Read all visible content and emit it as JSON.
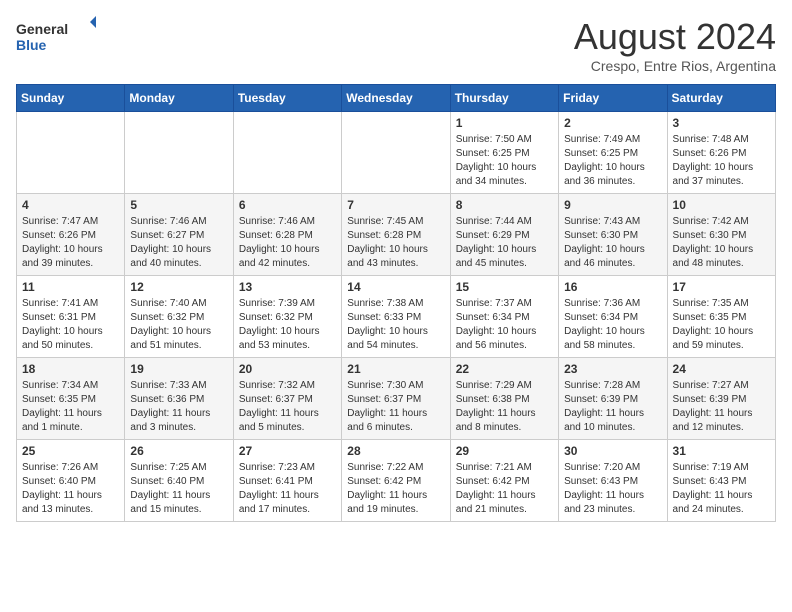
{
  "logo": {
    "line1": "General",
    "line2": "Blue"
  },
  "title": "August 2024",
  "subtitle": "Crespo, Entre Rios, Argentina",
  "weekdays": [
    "Sunday",
    "Monday",
    "Tuesday",
    "Wednesday",
    "Thursday",
    "Friday",
    "Saturday"
  ],
  "weeks": [
    [
      {
        "day": "",
        "info": ""
      },
      {
        "day": "",
        "info": ""
      },
      {
        "day": "",
        "info": ""
      },
      {
        "day": "",
        "info": ""
      },
      {
        "day": "1",
        "info": "Sunrise: 7:50 AM\nSunset: 6:25 PM\nDaylight: 10 hours\nand 34 minutes."
      },
      {
        "day": "2",
        "info": "Sunrise: 7:49 AM\nSunset: 6:25 PM\nDaylight: 10 hours\nand 36 minutes."
      },
      {
        "day": "3",
        "info": "Sunrise: 7:48 AM\nSunset: 6:26 PM\nDaylight: 10 hours\nand 37 minutes."
      }
    ],
    [
      {
        "day": "4",
        "info": "Sunrise: 7:47 AM\nSunset: 6:26 PM\nDaylight: 10 hours\nand 39 minutes."
      },
      {
        "day": "5",
        "info": "Sunrise: 7:46 AM\nSunset: 6:27 PM\nDaylight: 10 hours\nand 40 minutes."
      },
      {
        "day": "6",
        "info": "Sunrise: 7:46 AM\nSunset: 6:28 PM\nDaylight: 10 hours\nand 42 minutes."
      },
      {
        "day": "7",
        "info": "Sunrise: 7:45 AM\nSunset: 6:28 PM\nDaylight: 10 hours\nand 43 minutes."
      },
      {
        "day": "8",
        "info": "Sunrise: 7:44 AM\nSunset: 6:29 PM\nDaylight: 10 hours\nand 45 minutes."
      },
      {
        "day": "9",
        "info": "Sunrise: 7:43 AM\nSunset: 6:30 PM\nDaylight: 10 hours\nand 46 minutes."
      },
      {
        "day": "10",
        "info": "Sunrise: 7:42 AM\nSunset: 6:30 PM\nDaylight: 10 hours\nand 48 minutes."
      }
    ],
    [
      {
        "day": "11",
        "info": "Sunrise: 7:41 AM\nSunset: 6:31 PM\nDaylight: 10 hours\nand 50 minutes."
      },
      {
        "day": "12",
        "info": "Sunrise: 7:40 AM\nSunset: 6:32 PM\nDaylight: 10 hours\nand 51 minutes."
      },
      {
        "day": "13",
        "info": "Sunrise: 7:39 AM\nSunset: 6:32 PM\nDaylight: 10 hours\nand 53 minutes."
      },
      {
        "day": "14",
        "info": "Sunrise: 7:38 AM\nSunset: 6:33 PM\nDaylight: 10 hours\nand 54 minutes."
      },
      {
        "day": "15",
        "info": "Sunrise: 7:37 AM\nSunset: 6:34 PM\nDaylight: 10 hours\nand 56 minutes."
      },
      {
        "day": "16",
        "info": "Sunrise: 7:36 AM\nSunset: 6:34 PM\nDaylight: 10 hours\nand 58 minutes."
      },
      {
        "day": "17",
        "info": "Sunrise: 7:35 AM\nSunset: 6:35 PM\nDaylight: 10 hours\nand 59 minutes."
      }
    ],
    [
      {
        "day": "18",
        "info": "Sunrise: 7:34 AM\nSunset: 6:35 PM\nDaylight: 11 hours\nand 1 minute."
      },
      {
        "day": "19",
        "info": "Sunrise: 7:33 AM\nSunset: 6:36 PM\nDaylight: 11 hours\nand 3 minutes."
      },
      {
        "day": "20",
        "info": "Sunrise: 7:32 AM\nSunset: 6:37 PM\nDaylight: 11 hours\nand 5 minutes."
      },
      {
        "day": "21",
        "info": "Sunrise: 7:30 AM\nSunset: 6:37 PM\nDaylight: 11 hours\nand 6 minutes."
      },
      {
        "day": "22",
        "info": "Sunrise: 7:29 AM\nSunset: 6:38 PM\nDaylight: 11 hours\nand 8 minutes."
      },
      {
        "day": "23",
        "info": "Sunrise: 7:28 AM\nSunset: 6:39 PM\nDaylight: 11 hours\nand 10 minutes."
      },
      {
        "day": "24",
        "info": "Sunrise: 7:27 AM\nSunset: 6:39 PM\nDaylight: 11 hours\nand 12 minutes."
      }
    ],
    [
      {
        "day": "25",
        "info": "Sunrise: 7:26 AM\nSunset: 6:40 PM\nDaylight: 11 hours\nand 13 minutes."
      },
      {
        "day": "26",
        "info": "Sunrise: 7:25 AM\nSunset: 6:40 PM\nDaylight: 11 hours\nand 15 minutes."
      },
      {
        "day": "27",
        "info": "Sunrise: 7:23 AM\nSunset: 6:41 PM\nDaylight: 11 hours\nand 17 minutes."
      },
      {
        "day": "28",
        "info": "Sunrise: 7:22 AM\nSunset: 6:42 PM\nDaylight: 11 hours\nand 19 minutes."
      },
      {
        "day": "29",
        "info": "Sunrise: 7:21 AM\nSunset: 6:42 PM\nDaylight: 11 hours\nand 21 minutes."
      },
      {
        "day": "30",
        "info": "Sunrise: 7:20 AM\nSunset: 6:43 PM\nDaylight: 11 hours\nand 23 minutes."
      },
      {
        "day": "31",
        "info": "Sunrise: 7:19 AM\nSunset: 6:43 PM\nDaylight: 11 hours\nand 24 minutes."
      }
    ]
  ]
}
